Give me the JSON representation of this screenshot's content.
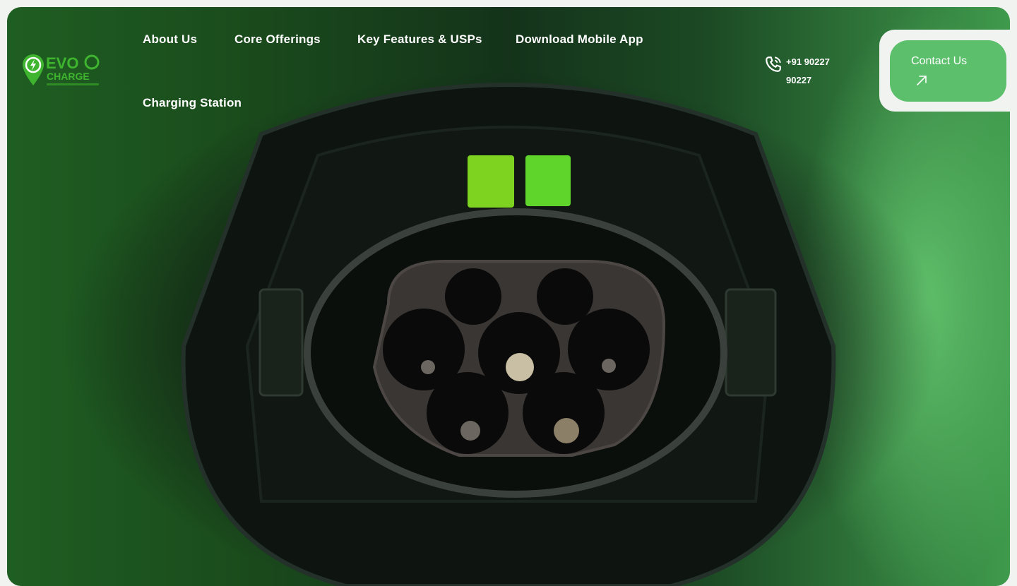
{
  "brand": {
    "line1": "EVO",
    "line2": "CHARGE",
    "accent_color": "#38b52f"
  },
  "nav": {
    "items": [
      {
        "label": "About Us"
      },
      {
        "label": "Core Offerings"
      },
      {
        "label": "Key Features & USPs"
      },
      {
        "label": "Download Mobile App"
      },
      {
        "label": "Charging Station"
      }
    ]
  },
  "contact": {
    "phone_line1": "+91 90227",
    "phone_line2": "90227",
    "phone_icon": "phone-icon",
    "button_label": "Contact Us",
    "button_icon": "arrow-up-right-icon",
    "button_color": "#5cbf6b"
  },
  "hero": {
    "image_subject": "ev-charging-socket",
    "indicator_color": "#7ed321"
  }
}
